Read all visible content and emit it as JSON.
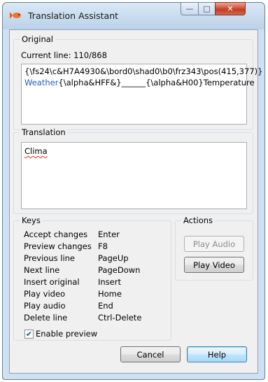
{
  "window": {
    "title": "Translation Assistant",
    "caption_buttons": {
      "minimize": "—",
      "maximize": "□",
      "close": "✕"
    }
  },
  "original": {
    "group_label": "Original",
    "current_line_label": "Current line: 110/868",
    "line1": "{\\fs24\\c&H7A4930&\\bord0\\shad0\\b0\\frz343\\pos(415,377)}",
    "line2_highlight": "Weather",
    "line2_rest": "{\\alpha&HFF&}______{\\alpha&H00}Temperature",
    "highlight_color": "#1f5fbf"
  },
  "translation": {
    "group_label": "Translation",
    "text": "Clima"
  },
  "keys": {
    "group_label": "Keys",
    "rows": [
      {
        "action": "Accept changes",
        "key": "Enter"
      },
      {
        "action": "Preview changes",
        "key": "F8"
      },
      {
        "action": "Previous line",
        "key": "PageUp"
      },
      {
        "action": "Next line",
        "key": "PageDown"
      },
      {
        "action": "Insert original",
        "key": "Insert"
      },
      {
        "action": "Play video",
        "key": "Home"
      },
      {
        "action": "Play audio",
        "key": "End"
      },
      {
        "action": "Delete line",
        "key": "Ctrl-Delete"
      }
    ],
    "enable_preview": {
      "label": "Enable preview",
      "checked": true
    }
  },
  "actions": {
    "group_label": "Actions",
    "play_audio": "Play Audio",
    "play_video": "Play Video"
  },
  "footer": {
    "cancel": "Cancel",
    "help": "Help"
  }
}
